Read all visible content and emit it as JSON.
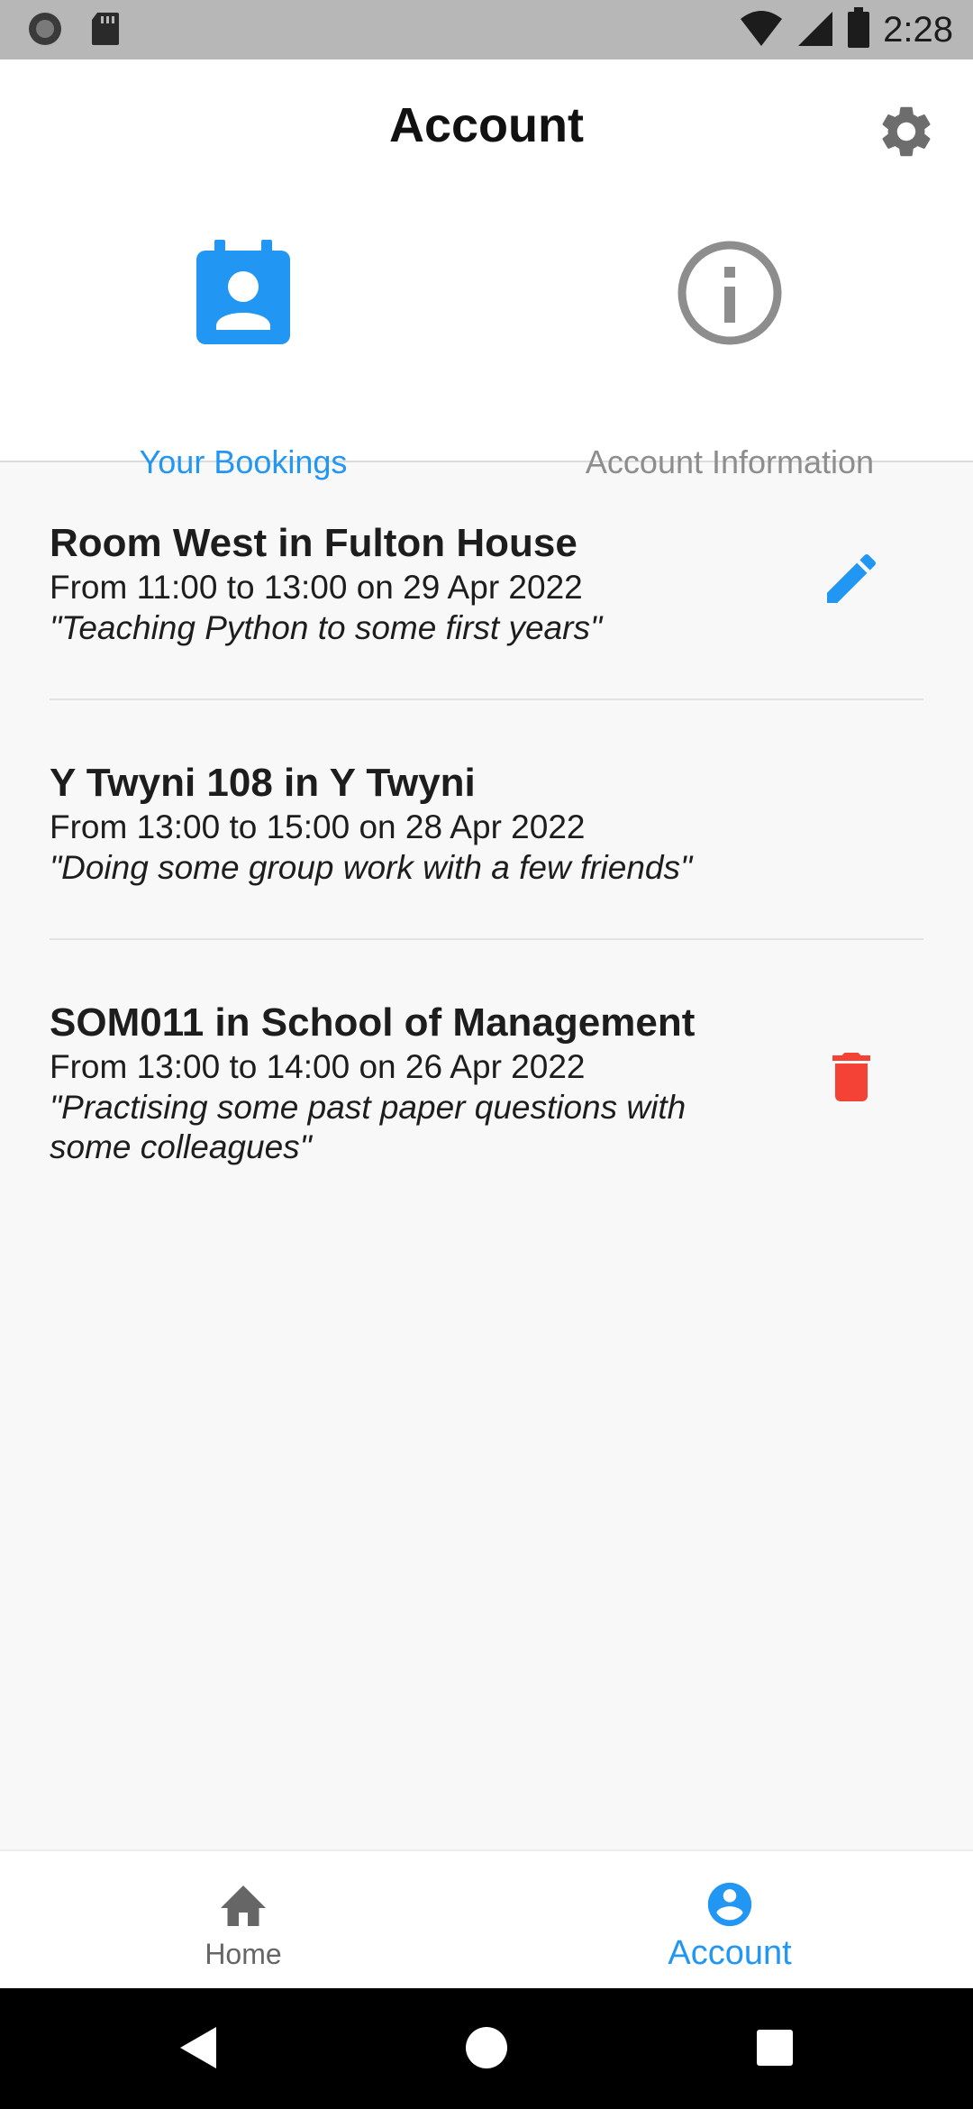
{
  "status_bar": {
    "time": "2:28"
  },
  "header": {
    "title": "Account"
  },
  "tabs": [
    {
      "label": "Your Bookings",
      "icon": "contact-calendar-icon",
      "active": true
    },
    {
      "label": "Account Information",
      "icon": "info-icon",
      "active": false
    }
  ],
  "bookings": [
    {
      "title": "Room West in Fulton House",
      "time": "From 11:00 to 13:00 on 29 Apr 2022",
      "note": "\"Teaching Python to some first years\"",
      "action": "edit-icon"
    },
    {
      "title": "Y Twyni 108 in Y Twyni",
      "time": "From 13:00 to 15:00 on 28 Apr 2022",
      "note": "\"Doing some group work with a few friends\"",
      "action": ""
    },
    {
      "title": "SOM011 in School of Management",
      "time": "From 13:00 to 14:00 on 26 Apr 2022",
      "note": "\"Practising some past paper questions with some colleagues\"",
      "action": "delete-icon"
    }
  ],
  "bottom_nav": {
    "home_label": "Home",
    "account_label": "Account"
  },
  "colors": {
    "accent": "#2196f3",
    "delete": "#f44336",
    "inactive": "#8d8d8d"
  }
}
